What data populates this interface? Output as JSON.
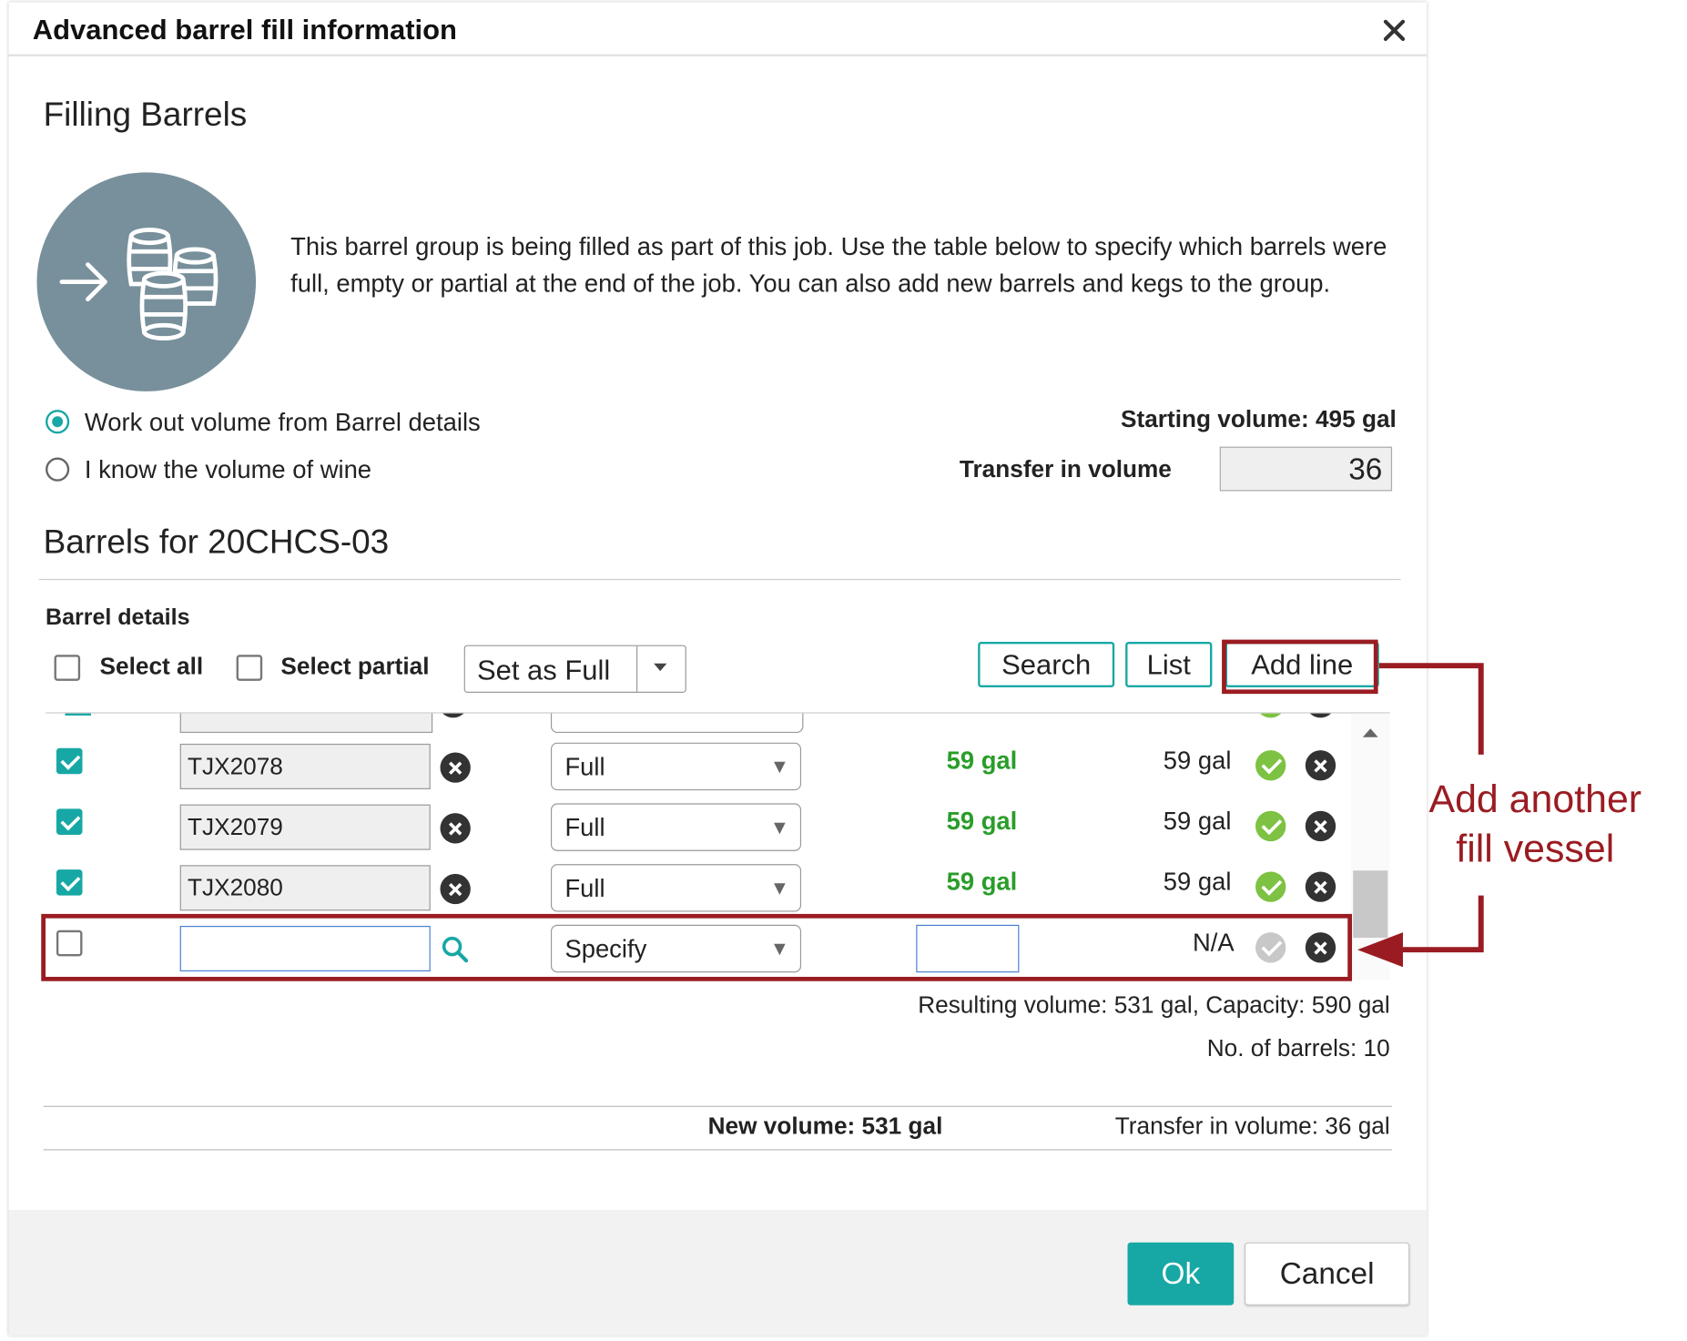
{
  "dialog": {
    "title": "Advanced barrel fill information",
    "heading": "Filling Barrels",
    "description": "This barrel group is being filled as part of this job. Use the table below to specify which barrels were full, empty or partial at the end of the job. You can also add new barrels and kegs to the group."
  },
  "volume_mode": {
    "option1": "Work out volume from Barrel details",
    "option2": "I know the volume of wine",
    "selected": "option1",
    "starting_volume": "Starting volume: 495 gal",
    "transfer_label": "Transfer in volume",
    "transfer_value": "36"
  },
  "barrels": {
    "heading": "Barrels for 20CHCS-03",
    "details_label": "Barrel details",
    "select_all": "Select all",
    "select_partial": "Select partial",
    "bulk_action": "Set as Full",
    "buttons": {
      "search": "Search",
      "list": "List",
      "add_line": "Add line"
    },
    "rows": [
      {
        "checked": true,
        "id": "TJX2078",
        "status": "Full",
        "fill": "59 gal",
        "capacity": "59 gal"
      },
      {
        "checked": true,
        "id": "TJX2079",
        "status": "Full",
        "fill": "59 gal",
        "capacity": "59 gal"
      },
      {
        "checked": true,
        "id": "TJX2080",
        "status": "Full",
        "fill": "59 gal",
        "capacity": "59 gal"
      }
    ],
    "new_row": {
      "checked": false,
      "id": "",
      "status": "Specify",
      "fill": "",
      "capacity": "N/A"
    },
    "resulting": "Resulting volume: 531 gal, Capacity: 590 gal",
    "count": "No. of barrels: 10"
  },
  "summary": {
    "new_volume": "New volume: 531 gal",
    "transfer_in": "Transfer in volume: 36 gal"
  },
  "footer": {
    "ok": "Ok",
    "cancel": "Cancel"
  },
  "annotation": {
    "line1": "Add another",
    "line2": "fill vessel"
  },
  "colors": {
    "accent": "#17a8a5",
    "green_text": "#2a9d2a",
    "annotation_red": "#9a1c22",
    "icon_circle": "#78909c"
  }
}
